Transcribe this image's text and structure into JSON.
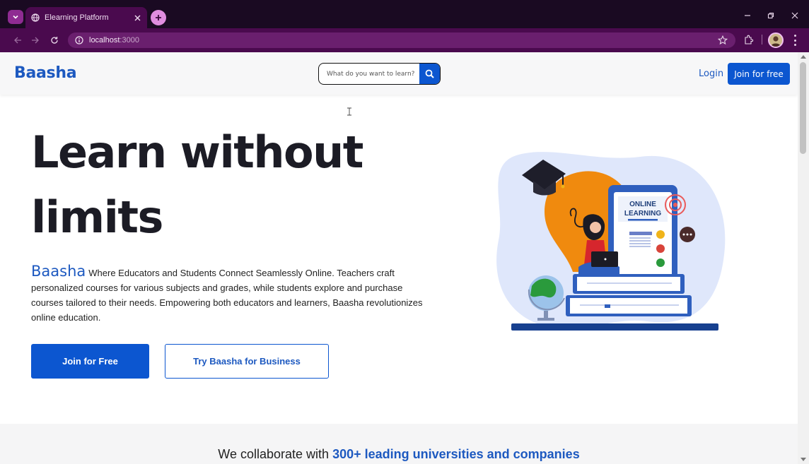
{
  "browser": {
    "tab_title": "Elearning Platform",
    "url_host": "localhost",
    "url_port": ":3000",
    "colors": {
      "frame": "#1a0a22",
      "toolbar": "#4a0a4e",
      "omnibox": "#6a1f6e"
    }
  },
  "header": {
    "brand": "Baasha",
    "search_placeholder": "What do you want to learn?",
    "login_label": "Login",
    "join_label": "Join for free"
  },
  "hero": {
    "title": "Learn without limits",
    "desc_brand": "Baasha",
    "description": "Where Educators and Students Connect Seamlessly Online. Teachers craft personalized courses for various subjects and grades, while students explore and purchase courses tailored to their needs. Empowering both educators and learners, Baasha revolutionizes online education.",
    "primary_cta": "Join for Free",
    "secondary_cta": "Try Baasha for Business",
    "illustration": {
      "screen_line1": "ONLINE",
      "screen_line2": "LEARNING"
    }
  },
  "collab": {
    "prefix": "We collaborate with",
    "highlight": "300+ leading universities and companies"
  },
  "colors": {
    "accent": "#0c56d0",
    "brand": "#1d59c0",
    "text": "#1c1c25"
  }
}
